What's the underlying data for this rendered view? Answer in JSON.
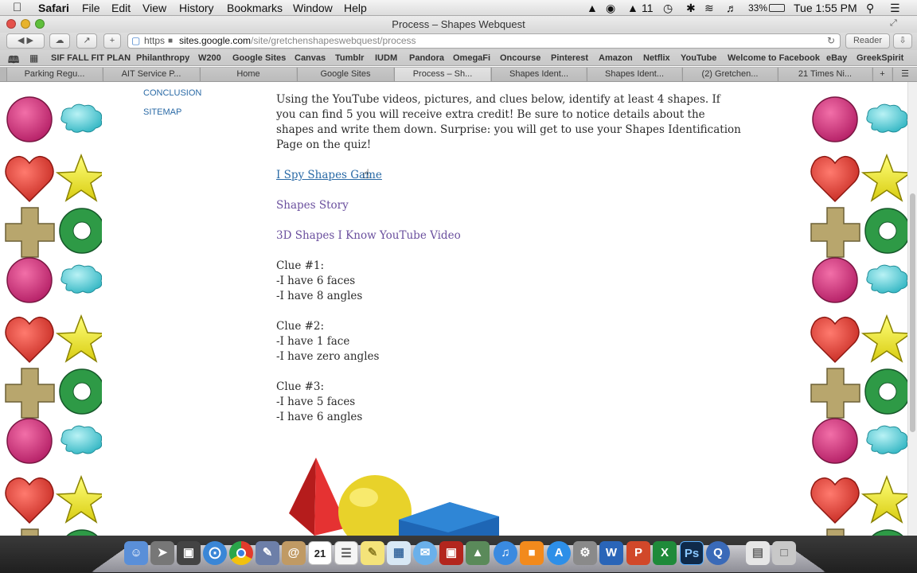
{
  "menubar": {
    "app_name": "Safari",
    "items": [
      "File",
      "Edit",
      "View",
      "History",
      "Bookmarks",
      "Window",
      "Help"
    ],
    "status": {
      "adobe": "11",
      "battery": "33%",
      "clock": "Tue 1:55 PM"
    }
  },
  "window": {
    "title": "Process – Shapes Webquest"
  },
  "toolbar": {
    "url_protocol": "https",
    "url_host": "sites.google.com",
    "url_path": "/site/gretchenshapeswebquest/process",
    "reader_label": "Reader"
  },
  "bookmarks": [
    "SIF FALL FIT PLAN",
    "Philanthropy",
    "W200",
    "Google Sites",
    "Canvas",
    "Tumblr",
    "IUDM",
    "Pandora",
    "OmegaFi",
    "Oncourse",
    "Pinterest",
    "Amazon",
    "Netflix",
    "YouTube",
    "Welcome to Facebook",
    "eBay",
    "GreekSpirit"
  ],
  "tabs": [
    "Parking Regu...",
    "AIT Service P...",
    "Home",
    "Google Sites",
    "Process – Sh...",
    "Shapes Ident...",
    "Shapes Ident...",
    "(2) Gretchen...",
    "21 Times Ni..."
  ],
  "sidebar": {
    "conclusion": "CONCLUSION",
    "sitemap": "SITEMAP"
  },
  "content": {
    "top_marker": "-",
    "intro": "Using the YouTube videos, pictures, and clues below, identify at least 4 shapes. If you can find 5 you will receive extra credit! Be sure to notice details about the shapes and write them down. Surprise: you will get to use your Shapes Identification Page on the quiz!",
    "link_game": "I Spy Shapes Game",
    "link_story": "Shapes Story",
    "link_video": "3D Shapes I Know YouTube Video",
    "clues": [
      {
        "title": "Clue #1:",
        "lines": [
          "-I have 6 faces",
          "-I have 8 angles"
        ]
      },
      {
        "title": "Clue #2:",
        "lines": [
          "-I have 1 face",
          "-I have zero angles"
        ]
      },
      {
        "title": "Clue #3:",
        "lines": [
          "-I have 5 faces",
          "-I have 6 angles"
        ]
      }
    ]
  },
  "dock": {
    "calendar_day": "21",
    "icons": [
      "finder-icon",
      "rocket-icon",
      "photo-booth-icon",
      "safari-icon",
      "chrome-icon",
      "preview-icon",
      "contacts-icon",
      "calendar-icon",
      "textedit-icon",
      "stickies-icon",
      "ical-icon",
      "messages-icon",
      "photo-icon",
      "iphoto-icon",
      "itunes-icon",
      "ibooks-icon",
      "app-store-icon",
      "system-prefs-icon",
      "word-icon",
      "powerpoint-icon",
      "excel-icon",
      "photoshop-icon",
      "quicktime-icon",
      "folder-icon",
      "trash-icon"
    ],
    "word": "W",
    "ppt": "P",
    "excel": "X",
    "ps": "Ps"
  },
  "colors": {
    "link": "#2a6aa6",
    "purple_link": "#6a4f9e",
    "text": "#2b2b2b"
  }
}
